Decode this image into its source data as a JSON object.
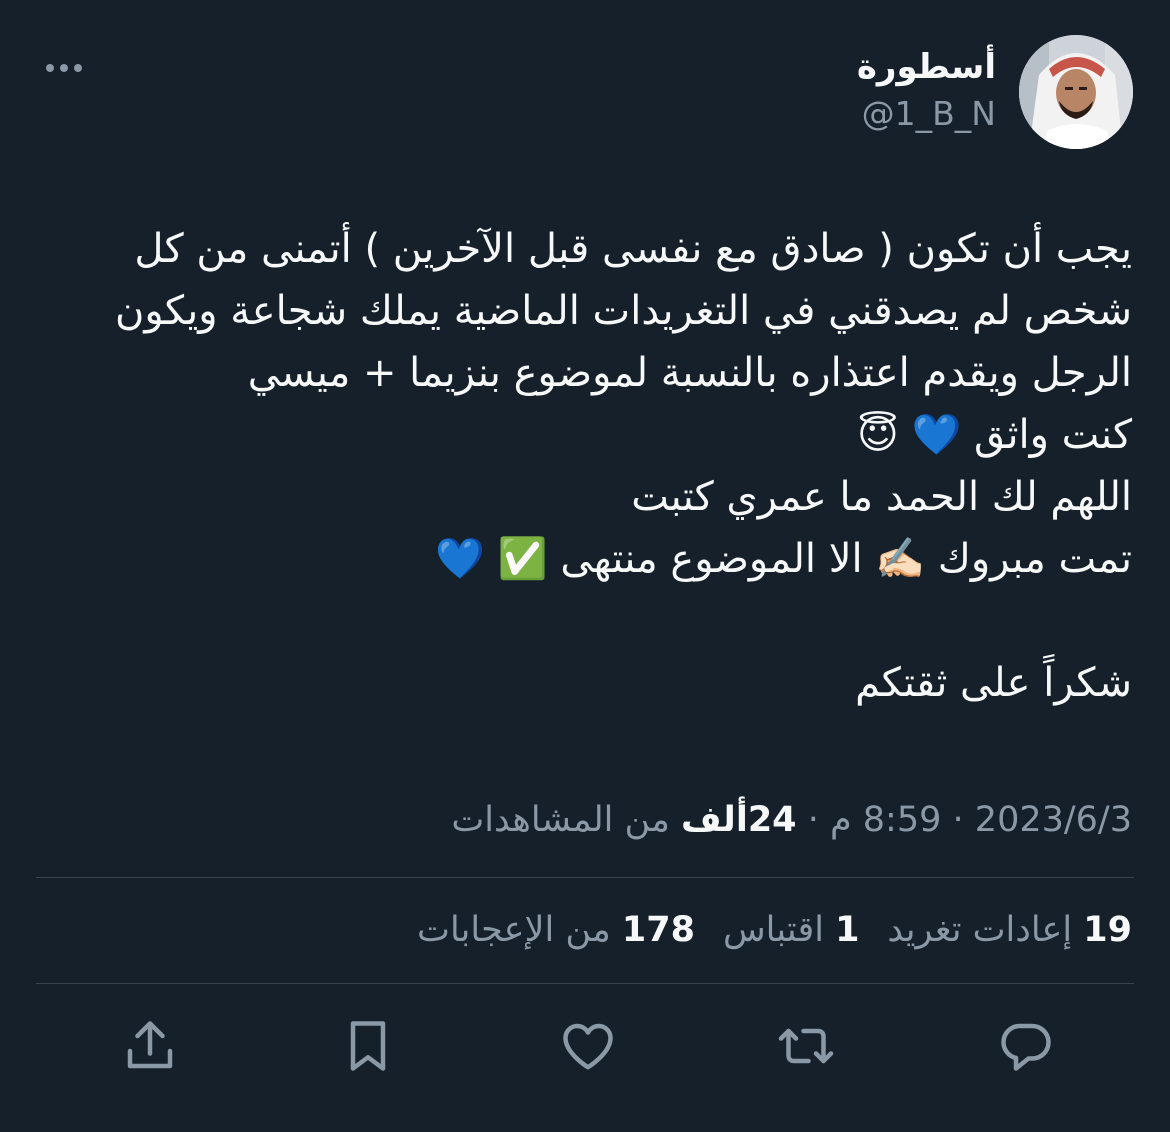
{
  "author": {
    "display_name": "أسطورة",
    "handle": "@1_B_N"
  },
  "tweet": {
    "lines": [
      "يجب أن تكون ( صادق مع نفسى قبل الآخرين ) أتمنى من كل",
      "شخص لم يصدقني في التغريدات الماضية يملك شجاعة ويكون",
      "الرجل ويقدم اعتذاره بالنسبة لموضوع بنزيما + ميسي",
      "كنت واثق 💙 😇",
      "اللهم لك الحمد ما عمري كتبت",
      "تمت مبروك ✍🏻 الا الموضوع منتهى ✅ 💙",
      "",
      "شكراً على ثقتكم"
    ]
  },
  "meta": {
    "date": "2023/6/3",
    "separator": "·",
    "time": "8:59 م",
    "views_count": "24ألف",
    "views_label": "من المشاهدات"
  },
  "stats": [
    {
      "count": "19",
      "label": "إعادات تغريد"
    },
    {
      "count": "1",
      "label": "اقتباس"
    },
    {
      "count": "178",
      "label": "من الإعجابات"
    }
  ],
  "colors": {
    "background": "#15202b",
    "text": "#f7f9f9",
    "muted": "#8b98a5",
    "divider": "#38444d"
  },
  "icons": [
    "more-icon",
    "reply-icon",
    "retweet-icon",
    "like-icon",
    "bookmark-icon",
    "share-icon"
  ]
}
